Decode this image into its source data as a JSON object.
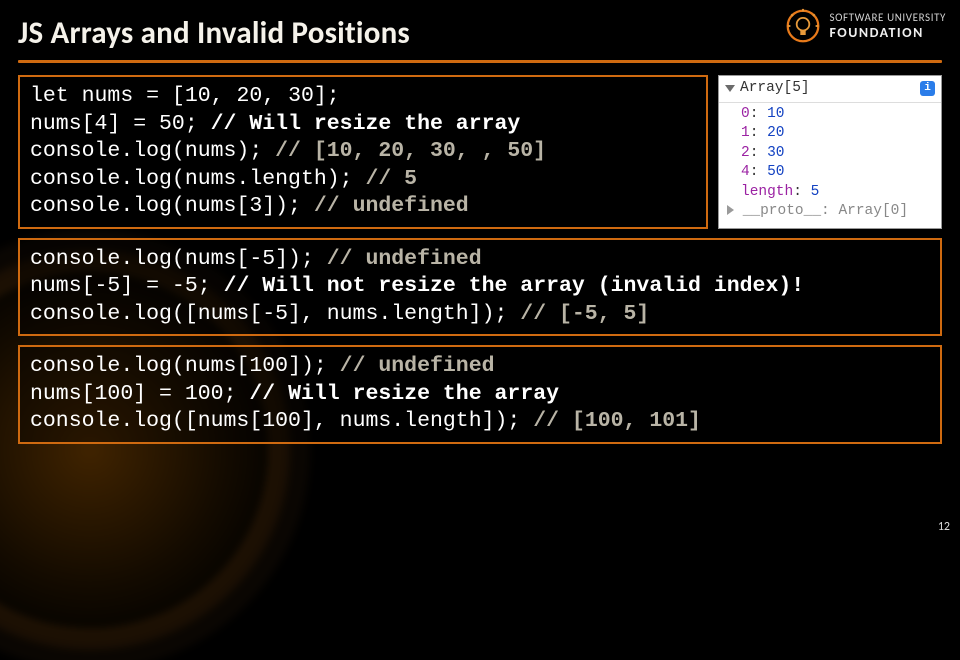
{
  "title": "JS Arrays and Invalid Positions",
  "page_number": "12",
  "logo": {
    "line1": "SOFTWARE UNIVERSITY",
    "line2": "FOUNDATION"
  },
  "code1": {
    "l1a": "let",
    "l1b": " nums = [",
    "l1c": "10",
    "l1d": ", ",
    "l1e": "20",
    "l1f": ", ",
    "l1g": "30",
    "l1h": "];",
    "l2a": "nums[",
    "l2b": "4",
    "l2c": "] = ",
    "l2d": "50",
    "l2e": "; ",
    "l2f": "// Will resize the array",
    "l3a": "console.log(nums); ",
    "l3b": "// [10, 20, 30, , 50]",
    "l4a": "console.log(nums.length); ",
    "l4b": "// 5",
    "l5a": "console.log(nums[",
    "l5b": "3",
    "l5c": "]); ",
    "l5d": "// undefined"
  },
  "inspector": {
    "header": "Array[5]",
    "entries": [
      {
        "k": "0",
        "v": "10"
      },
      {
        "k": "1",
        "v": "20"
      },
      {
        "k": "2",
        "v": "30"
      },
      {
        "k": "4",
        "v": "50"
      }
    ],
    "length_label": "length",
    "length_value": "5",
    "proto_label": "__proto__",
    "proto_value": "Array[0]"
  },
  "code2": {
    "l1a": "console.log(nums[-",
    "l1b": "5",
    "l1c": "]); ",
    "l1d": "// undefined",
    "l2a": "nums[-",
    "l2b": "5",
    "l2c": "] = -",
    "l2d": "5",
    "l2e": "; ",
    "l2f": "// Will not resize the array (invalid index)!",
    "l3a": "console.log([nums[-",
    "l3b": "5",
    "l3c": "], nums.length]); ",
    "l3d": "// [-5, 5]"
  },
  "code3": {
    "l1a": "console.log(nums[",
    "l1b": "100",
    "l1c": "]); ",
    "l1d": "// undefined",
    "l2a": "nums[",
    "l2b": "100",
    "l2c": "] = ",
    "l2d": "100",
    "l2e": "; ",
    "l2f": "// Will resize the array",
    "l3a": "console.log([nums[",
    "l3b": "100",
    "l3c": "], nums.length]); ",
    "l3d": "// [100, 101]"
  }
}
